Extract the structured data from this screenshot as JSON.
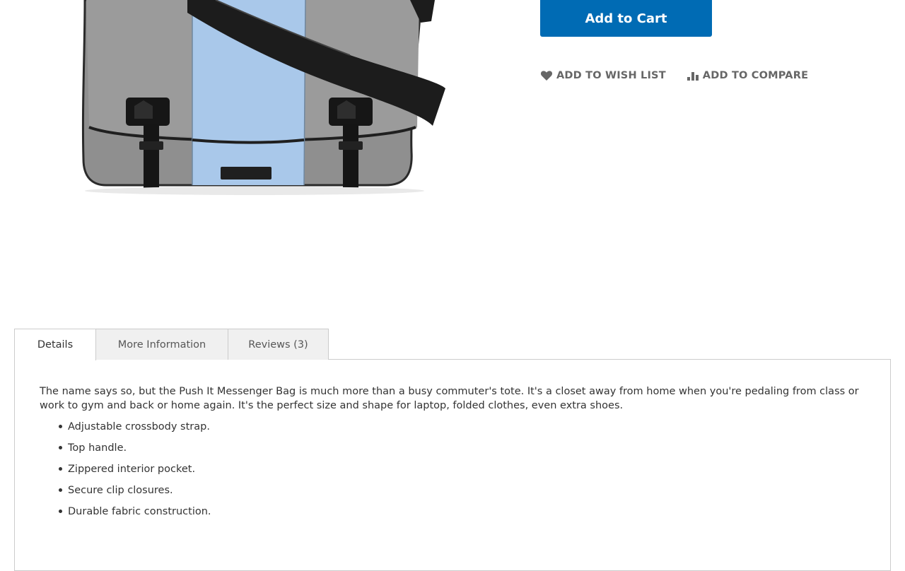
{
  "product": {
    "image_icon": "messenger-bag-image"
  },
  "actions": {
    "add_to_cart": "Add to Cart",
    "wish_list": "Add to Wish List",
    "compare": "Add to Compare",
    "accent_color": "#006bb4"
  },
  "tabs": [
    {
      "label": "Details"
    },
    {
      "label": "More Information"
    },
    {
      "label": "Reviews (3)"
    }
  ],
  "details": {
    "description": "The name says so, but the Push It Messenger Bag is much more than a busy commuter's tote. It's a closet away from home when you're pedaling from class or work to gym and back or home again. It's the perfect size and shape for laptop, folded clothes, even extra shoes.",
    "features": [
      "Adjustable crossbody strap.",
      "Top handle.",
      "Zippered interior pocket.",
      "Secure clip closures.",
      "Durable fabric construction."
    ]
  }
}
